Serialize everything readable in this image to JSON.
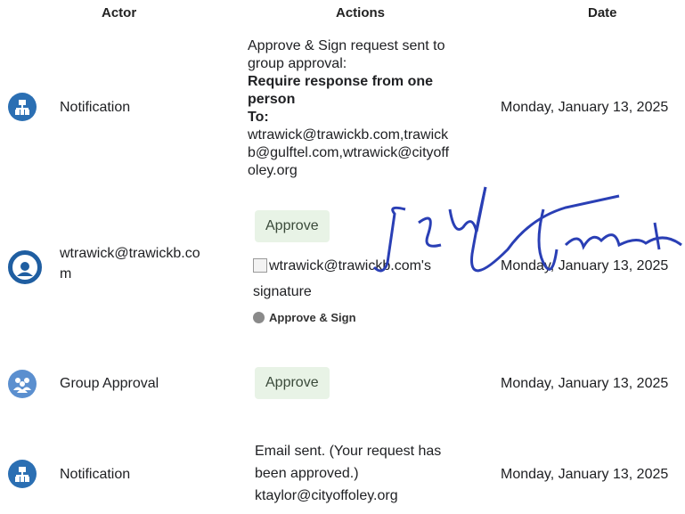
{
  "headers": {
    "actor": "Actor",
    "actions": "Actions",
    "date": "Date"
  },
  "rows": [
    {
      "icon": "org-chart-icon",
      "actor": "Notification",
      "action_lines": [
        "Approve & Sign request sent to",
        "group approval:"
      ],
      "action_bold": [
        "Require response from one",
        "person",
        "To:"
      ],
      "action_email": [
        "wtrawick@trawickb.com,trawick",
        "b@gulftel.com,wtrawick@cityoff",
        "oley.org"
      ],
      "date": "Monday, January 13, 2025"
    },
    {
      "icon": "user-avatar-icon",
      "actor_lines": [
        "wtrawick@trawickb.co",
        "m"
      ],
      "button": "Approve",
      "signature_alt_lines": [
        "wtrawick@trawickb.com's",
        "signature"
      ],
      "status": "Approve & Sign",
      "date": "Monday, January 13, 2025"
    },
    {
      "icon": "group-icon",
      "actor": "Group Approval",
      "button": "Approve",
      "date": "Monday, January 13, 2025"
    },
    {
      "icon": "org-chart-icon",
      "actor": "Notification",
      "action_lines": [
        "Email sent. (Your request has",
        "been approved.)",
        "ktaylor@cityoffoley.org"
      ],
      "date": "Monday, January 13, 2025"
    }
  ]
}
